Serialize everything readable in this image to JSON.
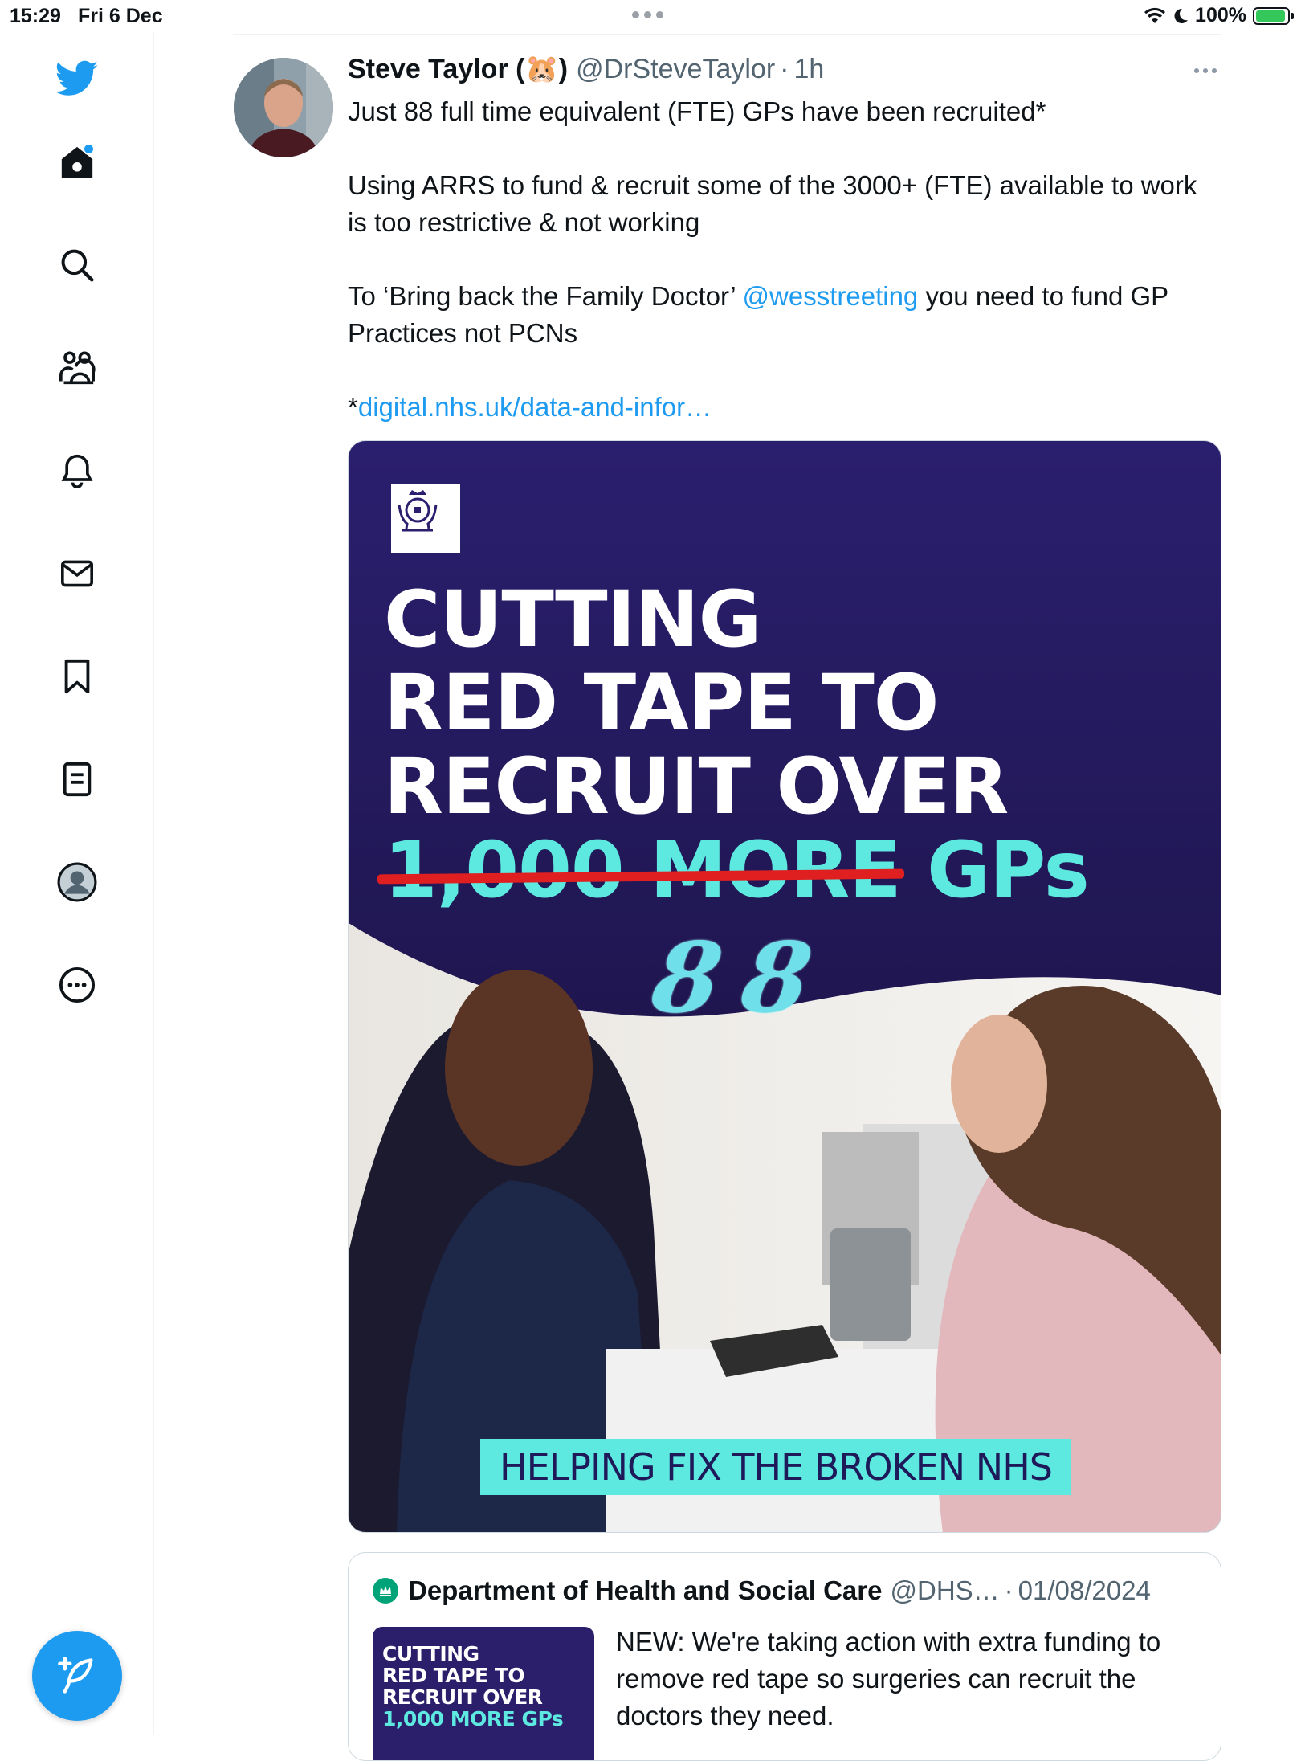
{
  "status_bar": {
    "time": "15:29",
    "date": "Fri 6 Dec",
    "battery": "100%"
  },
  "sidebar": {
    "items": [
      {
        "name": "home",
        "icon": "home-icon",
        "has_notification": true
      },
      {
        "name": "explore",
        "icon": "search-icon"
      },
      {
        "name": "communities",
        "icon": "communities-icon"
      },
      {
        "name": "notifications",
        "icon": "bell-icon"
      },
      {
        "name": "messages",
        "icon": "mail-icon"
      },
      {
        "name": "bookmarks",
        "icon": "bookmark-icon"
      },
      {
        "name": "lists",
        "icon": "list-icon"
      },
      {
        "name": "profile",
        "icon": "profile-icon"
      },
      {
        "name": "more",
        "icon": "more-circle-icon"
      }
    ],
    "compose_icon": "compose-feather-icon",
    "accent": "#1d9bf0"
  },
  "tweet": {
    "author_name": "Steve Taylor (🐹)",
    "handle": "@DrSteveTaylor",
    "separator": "·",
    "time": "1h",
    "body": {
      "line1": "Just 88 full time equivalent (FTE) GPs have been recruited*",
      "para2": "Using ARRS to fund & recruit some of the 3000+ (FTE) available to work is too restrictive & not working",
      "para3_start": "To ‘Bring back the Family Doctor’ ",
      "mention": "@wesstreeting",
      "para3_end": " you need to fund GP Practices not PCNs",
      "footnote_mark": "*",
      "link": "digital.nhs.uk/data-and-infor…"
    },
    "media": {
      "headline_line1": "CUTTING",
      "headline_line2": "RED TAPE TO",
      "headline_line3": "RECRUIT OVER",
      "struck_text": "1,000 MORE",
      "headline_end": "GPs",
      "handwritten": "88",
      "banner": "HELPING FIX THE BROKEN NHS"
    }
  },
  "quote": {
    "name": "Department of Health and Social Care",
    "handle": "@DHS…",
    "separator": "·",
    "date": "01/08/2024",
    "thumb_line1": "CUTTING",
    "thumb_line2": "RED TAPE TO",
    "thumb_line3": "RECRUIT OVER",
    "thumb_line4": "1,000 MORE GPs",
    "text": "NEW: We're taking action with extra funding to remove red tape so surgeries can recruit the doctors they need."
  }
}
